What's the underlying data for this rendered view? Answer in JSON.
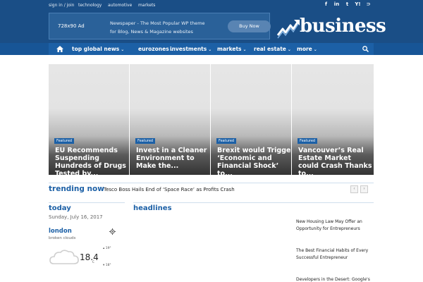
{
  "topbar": {
    "signin": "sign in / join",
    "links": [
      "technology",
      "automotive",
      "markets"
    ]
  },
  "social_icons": [
    "facebook-icon",
    "linkedin-icon",
    "twitter-icon",
    "yahoo-icon",
    "rss-icon"
  ],
  "social_glyphs": [
    "f",
    "in",
    "t",
    "Y!",
    "⊃"
  ],
  "ad": {
    "size": "728x90 Ad",
    "text": "Newspaper - The Most Popular WP theme for Blog, News & Magazine websites",
    "button": "Buy Now"
  },
  "logo": {
    "text": "business"
  },
  "nav": {
    "items": [
      {
        "label": "top global news",
        "dropdown": true
      },
      {
        "label": "eurozones",
        "dropdown": true
      },
      {
        "label": "investments",
        "dropdown": true
      },
      {
        "label": "markets",
        "dropdown": true
      },
      {
        "label": "real estate",
        "dropdown": true
      },
      {
        "label": "more",
        "dropdown": true
      }
    ]
  },
  "featured": [
    {
      "badge": "Featured",
      "title": "EU Recommends Suspending Hundreds of Drugs Tested by..."
    },
    {
      "badge": "Featured",
      "title": "Invest in a Cleaner Environment to Make the..."
    },
    {
      "badge": "Featured",
      "title": "Brexit would Trigger ‘Economic and Financial Shock’ to..."
    },
    {
      "badge": "Featured",
      "title": "Vancouver’s Real Estate Market could Crash Thanks to..."
    }
  ],
  "trending": {
    "label": "trending now",
    "title": "Tesco Boss Hails End of ‘Space Race’ as Profits Crash"
  },
  "today": {
    "title": "today",
    "date": "Sunday, July 16, 2017"
  },
  "weather": {
    "city": "london",
    "condition": "broken clouds",
    "temp": "18.4",
    "unit": "C",
    "high": "19°",
    "low": "18°"
  },
  "headlines": {
    "title": "headlines",
    "items": [
      "New Housing Law May Offer an Opportunity for Entrepreneurs",
      "The Best Financial Habits of Every Successful Entrepreneur",
      "Developers in the Desert: Google's"
    ]
  },
  "colors": {
    "brand": "#1a4e86",
    "nav": "#1c60a6",
    "accent": "#1c60a6"
  }
}
